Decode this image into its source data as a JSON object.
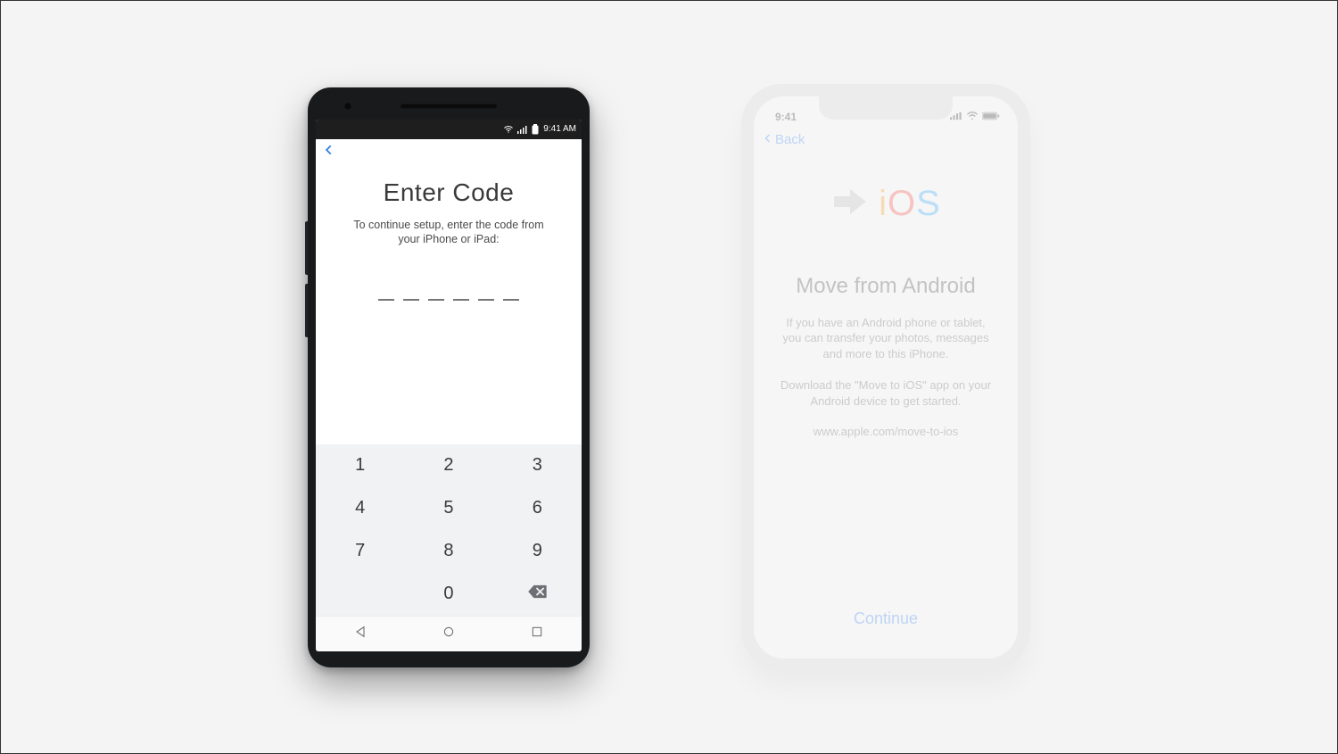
{
  "android": {
    "statusbar": {
      "time": "9:41 AM"
    },
    "title": "Enter Code",
    "subtitle": "To continue setup, enter the code from your iPhone or iPad:",
    "code_length": 6,
    "keypad": [
      "1",
      "2",
      "3",
      "4",
      "5",
      "6",
      "7",
      "8",
      "9",
      "",
      "0",
      "backspace"
    ]
  },
  "iphone": {
    "statusbar": {
      "time": "9:41"
    },
    "back_label": "Back",
    "logo_text": "iOS",
    "title": "Move from Android",
    "paragraph1": "If you have an Android phone or tablet, you can transfer your photos, messages and more to this iPhone.",
    "paragraph2": "Download the \"Move to iOS\" app on your Android device to get started.",
    "link": "www.apple.com/move-to-ios",
    "continue_label": "Continue"
  }
}
